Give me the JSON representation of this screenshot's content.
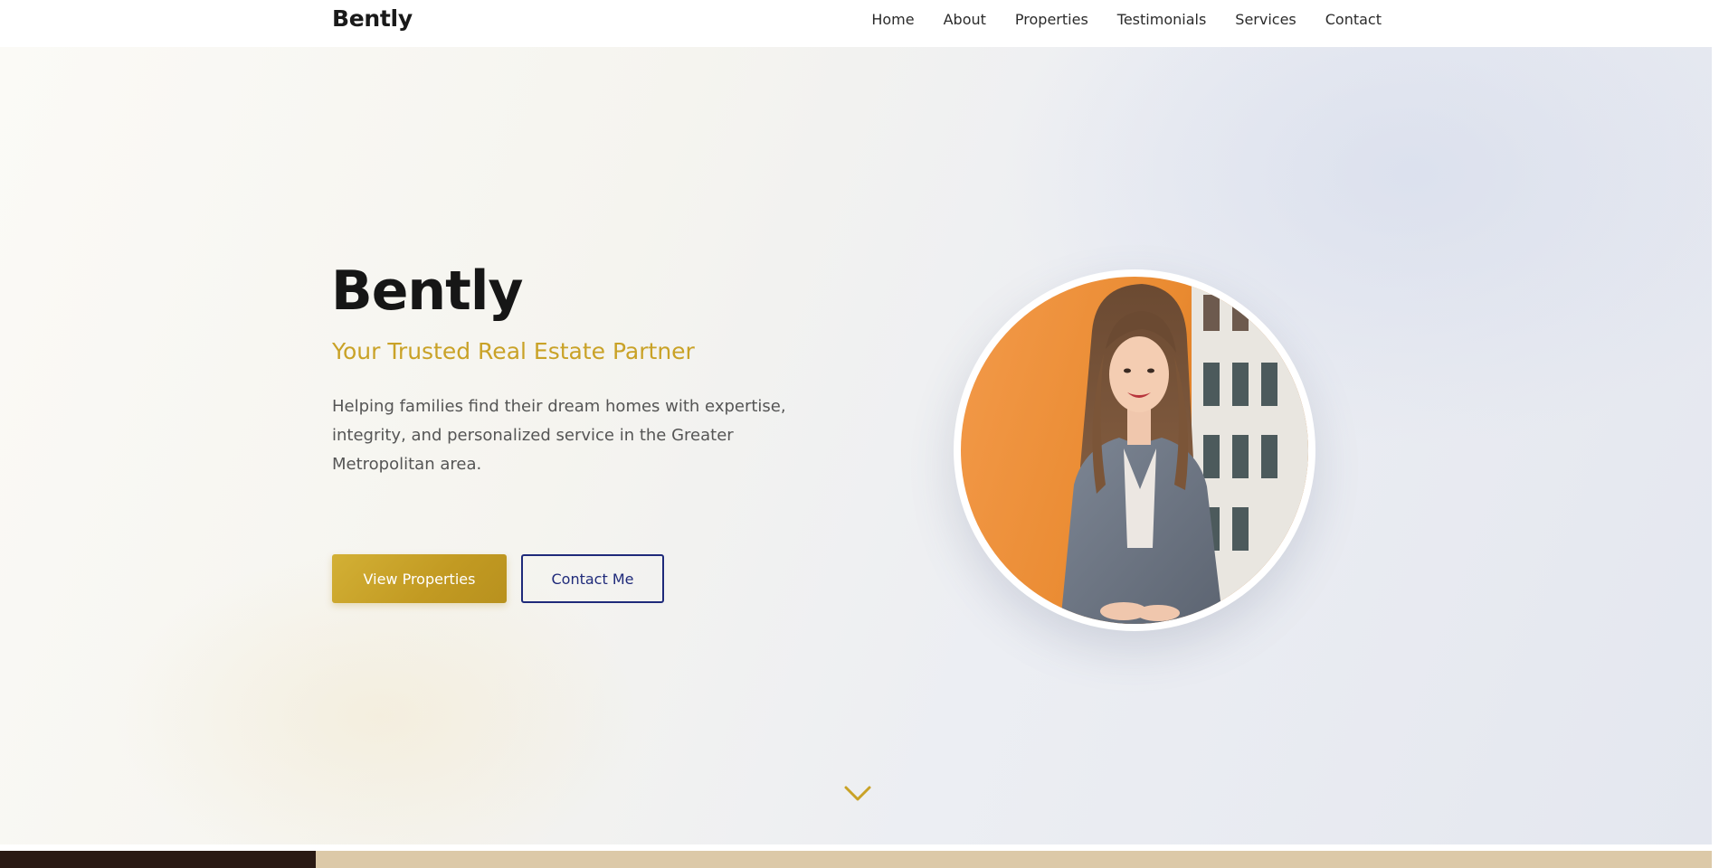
{
  "nav": {
    "brand": "Bently",
    "links": [
      "Home",
      "About",
      "Properties",
      "Testimonials",
      "Services",
      "Contact"
    ]
  },
  "hero": {
    "title": "Bently",
    "subtitle": "Your Trusted Real Estate Partner",
    "description": "Helping families find their dream homes with expertise, integrity, and personalized service in the Greater Metropolitan area.",
    "primary_button": "View Properties",
    "secondary_button": "Contact Me"
  },
  "colors": {
    "accent_gold": "#c9a227",
    "navy": "#1f2a7a",
    "text_dark": "#161616"
  },
  "icons": {
    "scroll": "chevron-down-icon"
  }
}
